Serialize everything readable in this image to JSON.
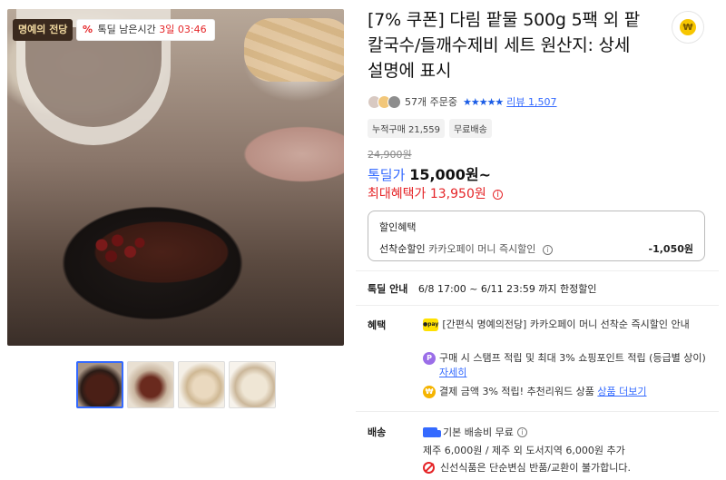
{
  "image": {
    "brand_badge": "명예의 전당",
    "timer_prefix": "%",
    "timer_label": "톡딜 남은시간",
    "timer_value": "3일 03:46"
  },
  "product": {
    "title": "[7% 쿠폰] 다림 팥물 500g 5팩 외 팥칼국수/들깨수제비 세트 원산지: 상세설명에 표시",
    "share_icon_text": "₩",
    "order_count": "57개 주문중",
    "stars": "★★★★★",
    "review_label": "리뷰 1,507",
    "tags": [
      "누적구매 21,559",
      "무료배송"
    ],
    "original_price": "24,900원",
    "deal_label": "톡딜가",
    "deal_price": "15,000원~",
    "max_label": "최대혜택가",
    "max_price": "13,950원",
    "info_glyph": "i"
  },
  "discount": {
    "header": "할인혜택",
    "row_label": "선착순할인",
    "row_desc": "카카오페이 머니 즉시할인",
    "row_amount": "-1,050원"
  },
  "special": {
    "label": "톡딜 안내",
    "text": "6/8 17:00 ~ 6/11 23:59 까지 한정할인"
  },
  "benefits": {
    "label": "혜택",
    "kpay_icon": "●pay",
    "p_icon": "P",
    "coin_icon": "₩",
    "items": [
      "[간편식 명예의전당] 카카오페이 머니 선착순 즉시할인 안내",
      "구매 시 스탬프 적립 및 최대 3% 쇼핑포인트 적립 (등급별 상이)",
      "결제 금액 3% 적립! 추천리워드 상품"
    ],
    "detail_link": "자세히",
    "more_link": "상품 더보기"
  },
  "shipping": {
    "label": "배송",
    "basic": "기본 배송비 무료",
    "extra": "제주 6,000원 / 제주 외 도서지역 6,000원 추가",
    "no_return": "신선식품은 단순변심 반품/교환이 불가합니다."
  }
}
